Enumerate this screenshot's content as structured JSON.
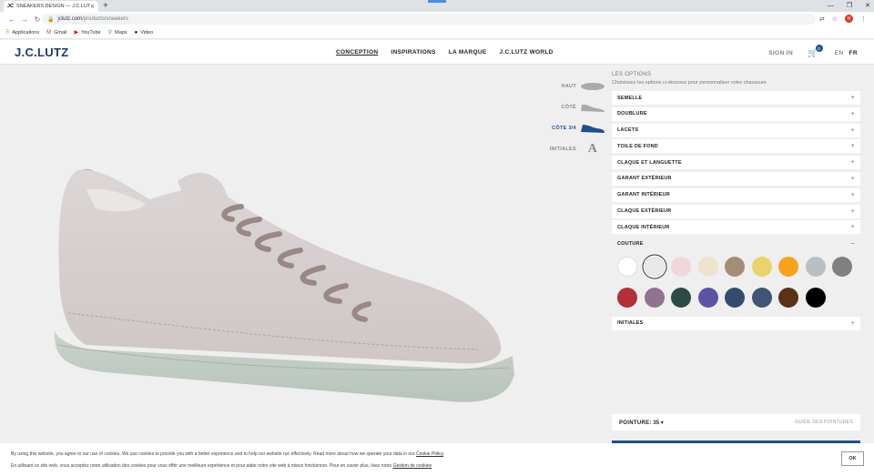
{
  "browser": {
    "tab_favicon": "JC",
    "tab_title": "SNEAKERS DESIGN — J.C.LUTZ",
    "url_host": "jclutz.com",
    "url_path": "/products/sneakers",
    "profile_initial": "H",
    "bookmarks": [
      {
        "label": "Applications",
        "icon": "apps-grid-icon"
      },
      {
        "label": "Gmail",
        "icon": "gmail-icon"
      },
      {
        "label": "YouTube",
        "icon": "youtube-icon"
      },
      {
        "label": "Maps",
        "icon": "maps-pin-icon"
      },
      {
        "label": "Video",
        "icon": "video-icon"
      }
    ]
  },
  "header": {
    "logo": "J.C.LUTZ",
    "nav": [
      "CONCEPTION",
      "INSPIRATIONS",
      "LA MARQUE",
      "J.C.LUTZ WORLD"
    ],
    "active_nav": "CONCEPTION",
    "signin": "SIGN IN",
    "cart_count": "0",
    "lang_en": "EN",
    "lang_fr": "FR"
  },
  "views": [
    {
      "label": "HAUT"
    },
    {
      "label": "CÔTÉ"
    },
    {
      "label": "CÔTE 3/4"
    },
    {
      "label": "INITIALES",
      "glyph": "A"
    }
  ],
  "options": {
    "title": "LES OPTIONS",
    "subtitle": "Choisissez les options ci-dessous pour personnaliser votre chaussure",
    "sections_before": [
      "SEMELLE",
      "DOUBLURE",
      "LACETS",
      "TOILE DE FOND",
      "CLAQUE ET LANGUETTE",
      "GARANT EXTÉRIEUR",
      "GARANT INTÉRIEUR",
      "CLAQUE EXTÉRIEUR",
      "CLAQUE INTÉRIEUR"
    ],
    "open_section": "COUTURE",
    "sections_after": [
      "INITIALES"
    ],
    "plus": "+",
    "minus": "–",
    "swatch_colors": [
      "#ffffff",
      "#e9e9e9",
      "#f0d6da",
      "#efe2cf",
      "#a48d76",
      "#e8d36c",
      "#f8a21b",
      "#b9bfc3",
      "#808080",
      "#b3303a",
      "#8f7390",
      "#2e4a44",
      "#5c53a2",
      "#354b6e",
      "#3f5573",
      "#5a3218",
      "#000000"
    ],
    "selected_index": 1
  },
  "pointure": {
    "label": "POINTURE:",
    "value": "35",
    "guide": "GUIDE DES POINTURES"
  },
  "cookies": {
    "line1": "By using this website, you agree to our use of cookies. We use cookies to provide you with a better experience and to help our website run effectively. Read more about how we operate your data in our",
    "link1": "Cookie Policy",
    "line2": "En utilisant ce site web, vous acceptez notre utilisation des cookies pour vous offrir une meilleure expérience et pour aider notre site web à mieux fonctionner. Pour en savoir plus, lisez notre",
    "link2": "Gestion de cookies",
    "ok": "OK"
  }
}
